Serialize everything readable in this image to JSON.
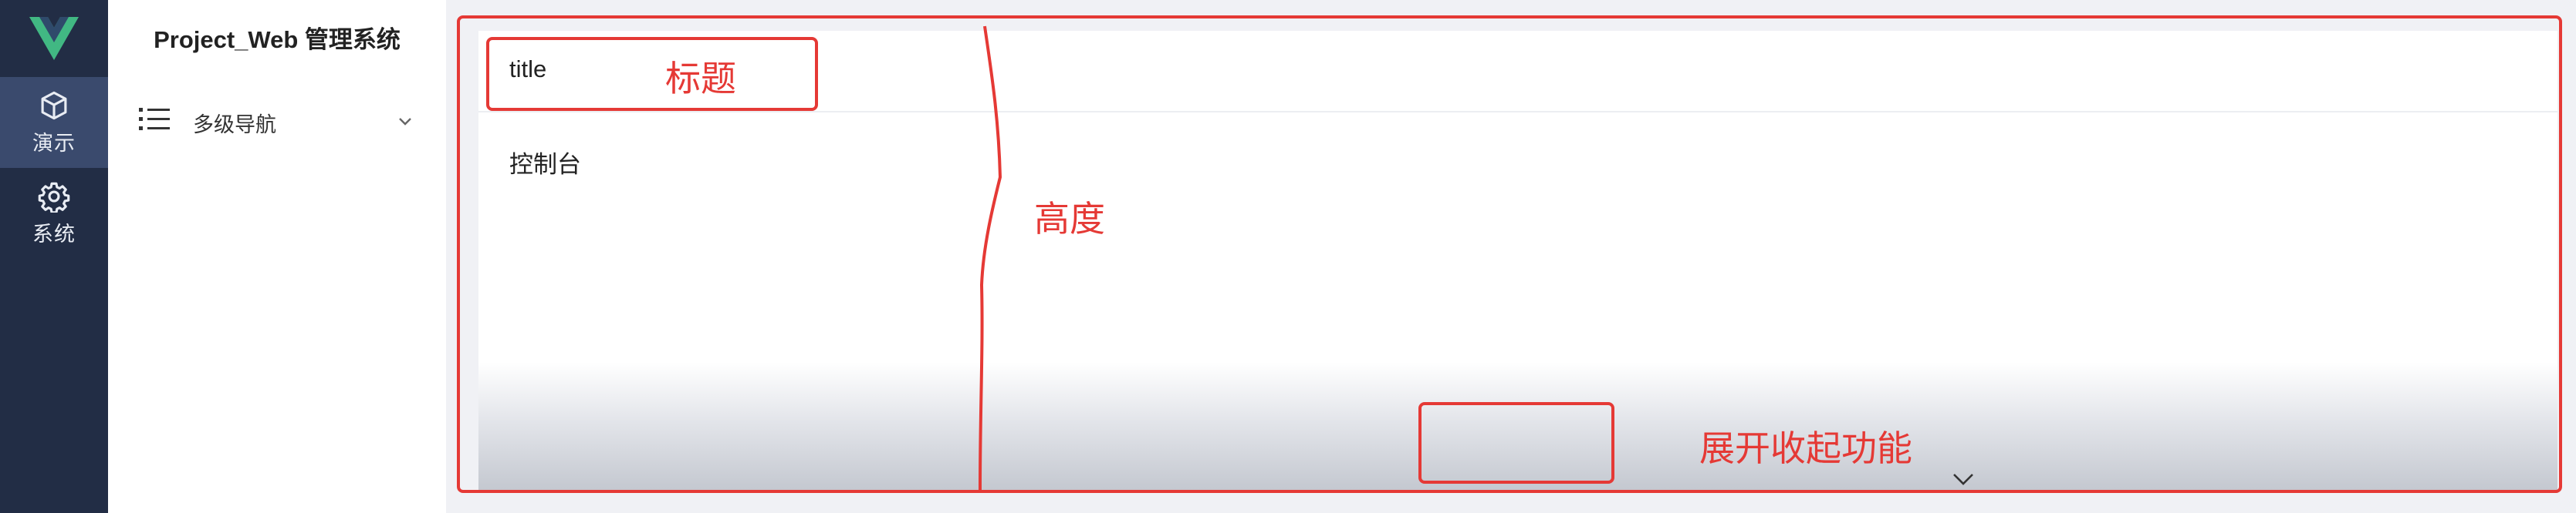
{
  "rail": {
    "items": [
      {
        "label": "演示",
        "icon": "cube-icon"
      },
      {
        "label": "系统",
        "icon": "gear-icon"
      }
    ],
    "logo": "vue-logo",
    "colors": {
      "background": "#222d45",
      "active": "#3a4a6d",
      "logo_green": "#41b883"
    }
  },
  "side": {
    "title": "Project_Web 管理系统",
    "menu": [
      {
        "label": "多级导航",
        "icon": "list-icon",
        "expand_icon": "chevron-down-icon"
      }
    ]
  },
  "main": {
    "card": {
      "title": "title",
      "body": "控制台",
      "toggle_icon": "chevron-down-icon"
    }
  },
  "annotations": {
    "title_label": "标题",
    "height_label": "高度",
    "toggle_label": "展开收起功能",
    "color": "#e53935"
  }
}
